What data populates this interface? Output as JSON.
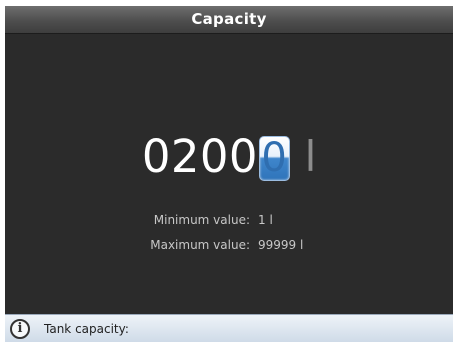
{
  "window": {
    "title": "Capacity"
  },
  "editor": {
    "digits": [
      "0",
      "2",
      "0",
      "0"
    ],
    "active_digit": "0",
    "unit": "l"
  },
  "limits": {
    "min_label": "Minimum value:",
    "min_value": "1 l",
    "max_label": "Maximum value:",
    "max_value": "99999 l"
  },
  "statusbar": {
    "icon": "info-icon",
    "icon_glyph": "i",
    "text": "Tank capacity:"
  },
  "colors": {
    "background": "#2b2b2b",
    "accent": "#2f74ba"
  }
}
